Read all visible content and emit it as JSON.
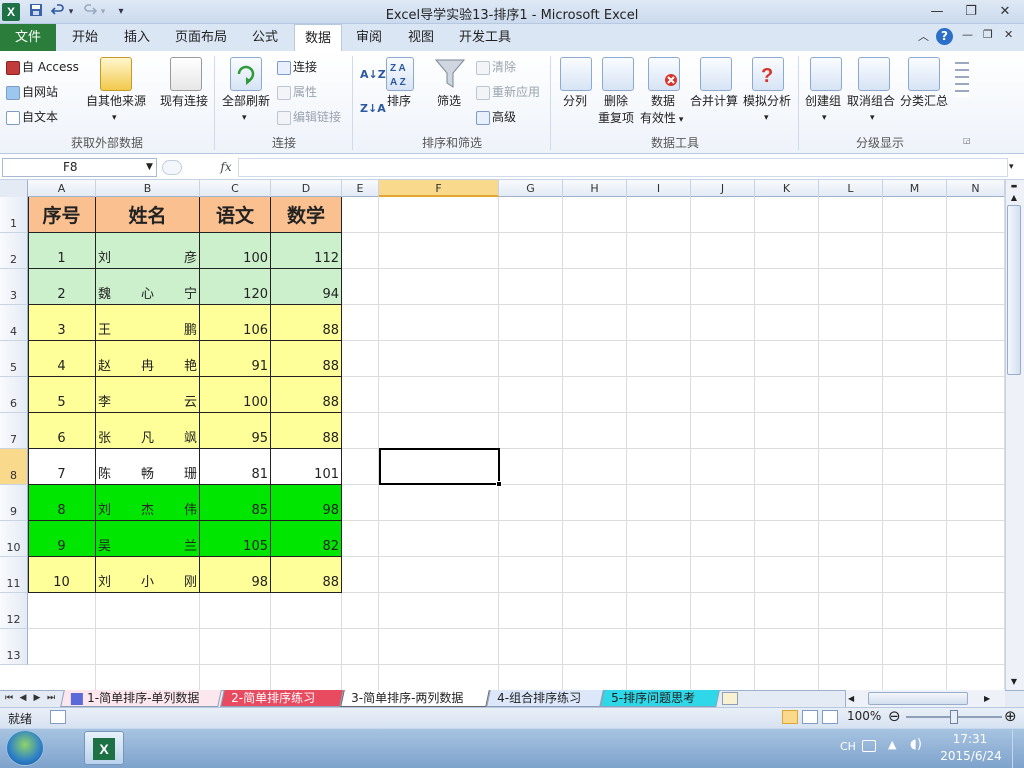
{
  "window": {
    "title": "Excel导学实验13-排序1  -  Microsoft Excel",
    "app_icon": "X"
  },
  "qat": {
    "save": "save-icon",
    "undo": "undo-icon",
    "redo": "redo-icon",
    "customize": "▾"
  },
  "ribbon_tabs": [
    {
      "label": "文件"
    },
    {
      "label": "开始"
    },
    {
      "label": "插入"
    },
    {
      "label": "页面布局"
    },
    {
      "label": "公式"
    },
    {
      "label": "数据"
    },
    {
      "label": "审阅"
    },
    {
      "label": "视图"
    },
    {
      "label": "开发工具"
    }
  ],
  "active_tab": "数据",
  "ribbon": {
    "get_external": {
      "label": "获取外部数据",
      "access": "自 Access",
      "web": "自网站",
      "text": "自文本",
      "other_sources": "自其他来源",
      "existing": "现有连接"
    },
    "connections": {
      "label": "连接",
      "refresh_all": "全部刷新",
      "connections": "连接",
      "properties": "属性",
      "edit_links": "编辑链接"
    },
    "sort_filter": {
      "label": "排序和筛选",
      "sort_az": "A↓Z",
      "sort_za": "Z↓A",
      "sort": "排序",
      "filter": "筛选",
      "clear": "清除",
      "reapply": "重新应用",
      "advanced": "高级"
    },
    "data_tools": {
      "label": "数据工具",
      "text_to_columns": "分列",
      "remove_dup_1": "删除",
      "remove_dup_2": "重复项",
      "validation_1": "数据",
      "validation_2": "有效性",
      "consolidate": "合并计算",
      "what_if": "模拟分析"
    },
    "outline": {
      "label": "分级显示",
      "group": "创建组",
      "ungroup": "取消组合",
      "subtotal": "分类汇总"
    }
  },
  "formula_bar": {
    "name_box": "F8",
    "fx": "fx",
    "formula": ""
  },
  "columns": [
    "A",
    "B",
    "C",
    "D",
    "E",
    "F",
    "G",
    "H",
    "I",
    "J",
    "K",
    "L",
    "M",
    "N"
  ],
  "selected_column": "F",
  "selected_row": "8",
  "rows": [
    "1",
    "2",
    "3",
    "4",
    "5",
    "6",
    "7",
    "8",
    "9",
    "10",
    "11",
    "12",
    "13"
  ],
  "table": {
    "headers": [
      "序号",
      "姓名",
      "语文",
      "数学"
    ],
    "records": [
      {
        "no": "1",
        "name": [
          "刘",
          "",
          "彦"
        ],
        "chinese": "100",
        "math": "112"
      },
      {
        "no": "2",
        "name": [
          "魏",
          "心",
          "宁"
        ],
        "chinese": "120",
        "math": "94"
      },
      {
        "no": "3",
        "name": [
          "王",
          "",
          "鹏"
        ],
        "chinese": "106",
        "math": "88"
      },
      {
        "no": "4",
        "name": [
          "赵",
          "冉",
          "艳"
        ],
        "chinese": "91",
        "math": "88"
      },
      {
        "no": "5",
        "name": [
          "李",
          "",
          "云"
        ],
        "chinese": "100",
        "math": "88"
      },
      {
        "no": "6",
        "name": [
          "张",
          "凡",
          "飒"
        ],
        "chinese": "95",
        "math": "88"
      },
      {
        "no": "7",
        "name": [
          "陈",
          "畅",
          "珊"
        ],
        "chinese": "81",
        "math": "101"
      },
      {
        "no": "8",
        "name": [
          "刘",
          "杰",
          "伟"
        ],
        "chinese": "85",
        "math": "98"
      },
      {
        "no": "9",
        "name": [
          "吴",
          "",
          "兰"
        ],
        "chinese": "105",
        "math": "82"
      },
      {
        "no": "10",
        "name": [
          "刘",
          "小",
          "刚"
        ],
        "chinese": "98",
        "math": "88"
      }
    ]
  },
  "colors": {
    "header_fill": "#fac090",
    "light_green": "#ccf0cc",
    "light_yellow": "#ffff99",
    "bright_green": "#00e600",
    "white": "#ffffff",
    "file_tab": "#2a7d3a",
    "selection": "#f9d98b"
  },
  "sheet_tabs": [
    {
      "label": "1-简单排序-单列数据",
      "color": "#5a6ad8"
    },
    {
      "label": "2-简单排序练习",
      "color": "#e84a5f"
    },
    {
      "label": "3-简单排序-两列数据",
      "color": "#ffffff"
    },
    {
      "label": "4-组合排序练习",
      "color": "#9ab8e8"
    },
    {
      "label": "5-排序问题思考",
      "color": "#2fd8e8"
    }
  ],
  "active_sheet": "3-简单排序-两列数据",
  "status": {
    "ready": "就绪",
    "zoom": "100%",
    "zoom_out": "⊖",
    "zoom_in": "⊕"
  },
  "taskbar": {
    "lang": "CH",
    "time": "17:31",
    "date": "2015/6/24"
  }
}
